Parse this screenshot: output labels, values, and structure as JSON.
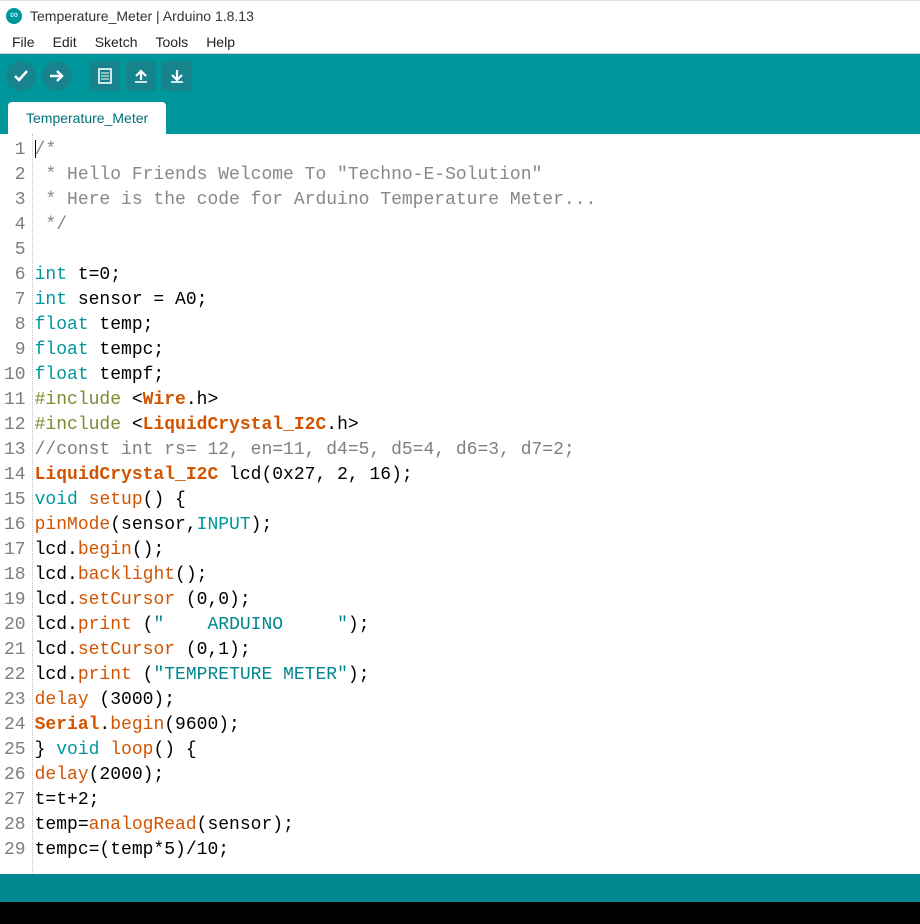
{
  "window": {
    "title": "Temperature_Meter | Arduino 1.8.13"
  },
  "menu": {
    "file": "File",
    "edit": "Edit",
    "sketch": "Sketch",
    "tools": "Tools",
    "help": "Help"
  },
  "tab": {
    "name": "Temperature_Meter"
  },
  "lines": [
    {
      "n": "1",
      "segments": [
        {
          "cls": "tok-comment-star",
          "t": "/*"
        }
      ],
      "cursor": true
    },
    {
      "n": "2",
      "segments": [
        {
          "cls": "tok-comment-star",
          "t": " * Hello Friends Welcome To \"Techno-E-Solution\""
        }
      ]
    },
    {
      "n": "3",
      "segments": [
        {
          "cls": "tok-comment-star",
          "t": " * Here is the code for Arduino Temperature Meter..."
        }
      ]
    },
    {
      "n": "4",
      "segments": [
        {
          "cls": "tok-comment-star",
          "t": " */"
        }
      ]
    },
    {
      "n": "5",
      "segments": [
        {
          "cls": "tok-black",
          "t": ""
        }
      ]
    },
    {
      "n": "6",
      "segments": [
        {
          "cls": "tok-type",
          "t": "int"
        },
        {
          "cls": "tok-black",
          "t": " t=0;"
        }
      ]
    },
    {
      "n": "7",
      "segments": [
        {
          "cls": "tok-type",
          "t": "int"
        },
        {
          "cls": "tok-black",
          "t": " sensor = A0;"
        }
      ]
    },
    {
      "n": "8",
      "segments": [
        {
          "cls": "tok-type",
          "t": "float"
        },
        {
          "cls": "tok-black",
          "t": " temp;"
        }
      ]
    },
    {
      "n": "9",
      "segments": [
        {
          "cls": "tok-type",
          "t": "float"
        },
        {
          "cls": "tok-black",
          "t": " tempc;"
        }
      ]
    },
    {
      "n": "10",
      "segments": [
        {
          "cls": "tok-type",
          "t": "float"
        },
        {
          "cls": "tok-black",
          "t": " tempf;"
        }
      ]
    },
    {
      "n": "11",
      "segments": [
        {
          "cls": "tok-pre",
          "t": "#include "
        },
        {
          "cls": "tok-black",
          "t": "<"
        },
        {
          "cls": "tok-orange-b",
          "t": "Wire"
        },
        {
          "cls": "tok-black",
          "t": ".h>"
        }
      ]
    },
    {
      "n": "12",
      "segments": [
        {
          "cls": "tok-pre",
          "t": "#include "
        },
        {
          "cls": "tok-black",
          "t": "<"
        },
        {
          "cls": "tok-orange-b",
          "t": "LiquidCrystal_I2C"
        },
        {
          "cls": "tok-black",
          "t": ".h>"
        }
      ]
    },
    {
      "n": "13",
      "segments": [
        {
          "cls": "tok-comment",
          "t": "//const int rs= 12, en=11, d4=5, d5=4, d6=3, d7=2;"
        }
      ]
    },
    {
      "n": "14",
      "segments": [
        {
          "cls": "tok-orange-b",
          "t": "LiquidCrystal_I2C"
        },
        {
          "cls": "tok-black",
          "t": " lcd(0x27, 2, 16);"
        }
      ]
    },
    {
      "n": "15",
      "segments": [
        {
          "cls": "tok-type",
          "t": "void"
        },
        {
          "cls": "tok-black",
          "t": " "
        },
        {
          "cls": "tok-orange",
          "t": "setup"
        },
        {
          "cls": "tok-black",
          "t": "() {"
        }
      ]
    },
    {
      "n": "16",
      "segments": [
        {
          "cls": "tok-orange",
          "t": "pinMode"
        },
        {
          "cls": "tok-black",
          "t": "(sensor,"
        },
        {
          "cls": "tok-keyword",
          "t": "INPUT"
        },
        {
          "cls": "tok-black",
          "t": ");"
        }
      ]
    },
    {
      "n": "17",
      "segments": [
        {
          "cls": "tok-black",
          "t": "lcd."
        },
        {
          "cls": "tok-orange",
          "t": "begin"
        },
        {
          "cls": "tok-black",
          "t": "();"
        }
      ]
    },
    {
      "n": "18",
      "segments": [
        {
          "cls": "tok-black",
          "t": "lcd."
        },
        {
          "cls": "tok-orange",
          "t": "backlight"
        },
        {
          "cls": "tok-black",
          "t": "();"
        }
      ]
    },
    {
      "n": "19",
      "segments": [
        {
          "cls": "tok-black",
          "t": "lcd."
        },
        {
          "cls": "tok-orange",
          "t": "setCursor"
        },
        {
          "cls": "tok-black",
          "t": " (0,0);"
        }
      ]
    },
    {
      "n": "20",
      "segments": [
        {
          "cls": "tok-black",
          "t": "lcd."
        },
        {
          "cls": "tok-orange",
          "t": "print"
        },
        {
          "cls": "tok-black",
          "t": " ("
        },
        {
          "cls": "tok-string",
          "t": "\"    ARDUINO     \""
        },
        {
          "cls": "tok-black",
          "t": ");"
        }
      ]
    },
    {
      "n": "21",
      "segments": [
        {
          "cls": "tok-black",
          "t": "lcd."
        },
        {
          "cls": "tok-orange",
          "t": "setCursor"
        },
        {
          "cls": "tok-black",
          "t": " (0,1);"
        }
      ]
    },
    {
      "n": "22",
      "segments": [
        {
          "cls": "tok-black",
          "t": "lcd."
        },
        {
          "cls": "tok-orange",
          "t": "print"
        },
        {
          "cls": "tok-black",
          "t": " ("
        },
        {
          "cls": "tok-string",
          "t": "\"TEMPRETURE METER\""
        },
        {
          "cls": "tok-black",
          "t": ");"
        }
      ]
    },
    {
      "n": "23",
      "segments": [
        {
          "cls": "tok-orange",
          "t": "delay"
        },
        {
          "cls": "tok-black",
          "t": " (3000);"
        }
      ]
    },
    {
      "n": "24",
      "segments": [
        {
          "cls": "tok-serial",
          "t": "Serial"
        },
        {
          "cls": "tok-black",
          "t": "."
        },
        {
          "cls": "tok-orange",
          "t": "begin"
        },
        {
          "cls": "tok-black",
          "t": "(9600);"
        }
      ]
    },
    {
      "n": "25",
      "segments": [
        {
          "cls": "tok-black",
          "t": "} "
        },
        {
          "cls": "tok-type",
          "t": "void"
        },
        {
          "cls": "tok-black",
          "t": " "
        },
        {
          "cls": "tok-orange",
          "t": "loop"
        },
        {
          "cls": "tok-black",
          "t": "() {"
        }
      ]
    },
    {
      "n": "26",
      "segments": [
        {
          "cls": "tok-orange",
          "t": "delay"
        },
        {
          "cls": "tok-black",
          "t": "(2000);"
        }
      ]
    },
    {
      "n": "27",
      "segments": [
        {
          "cls": "tok-black",
          "t": "t=t+2;"
        }
      ]
    },
    {
      "n": "28",
      "segments": [
        {
          "cls": "tok-black",
          "t": "temp="
        },
        {
          "cls": "tok-orange",
          "t": "analogRead"
        },
        {
          "cls": "tok-black",
          "t": "(sensor);"
        }
      ]
    },
    {
      "n": "29",
      "segments": [
        {
          "cls": "tok-black",
          "t": "tempc=(temp*5)/10;"
        }
      ]
    }
  ]
}
